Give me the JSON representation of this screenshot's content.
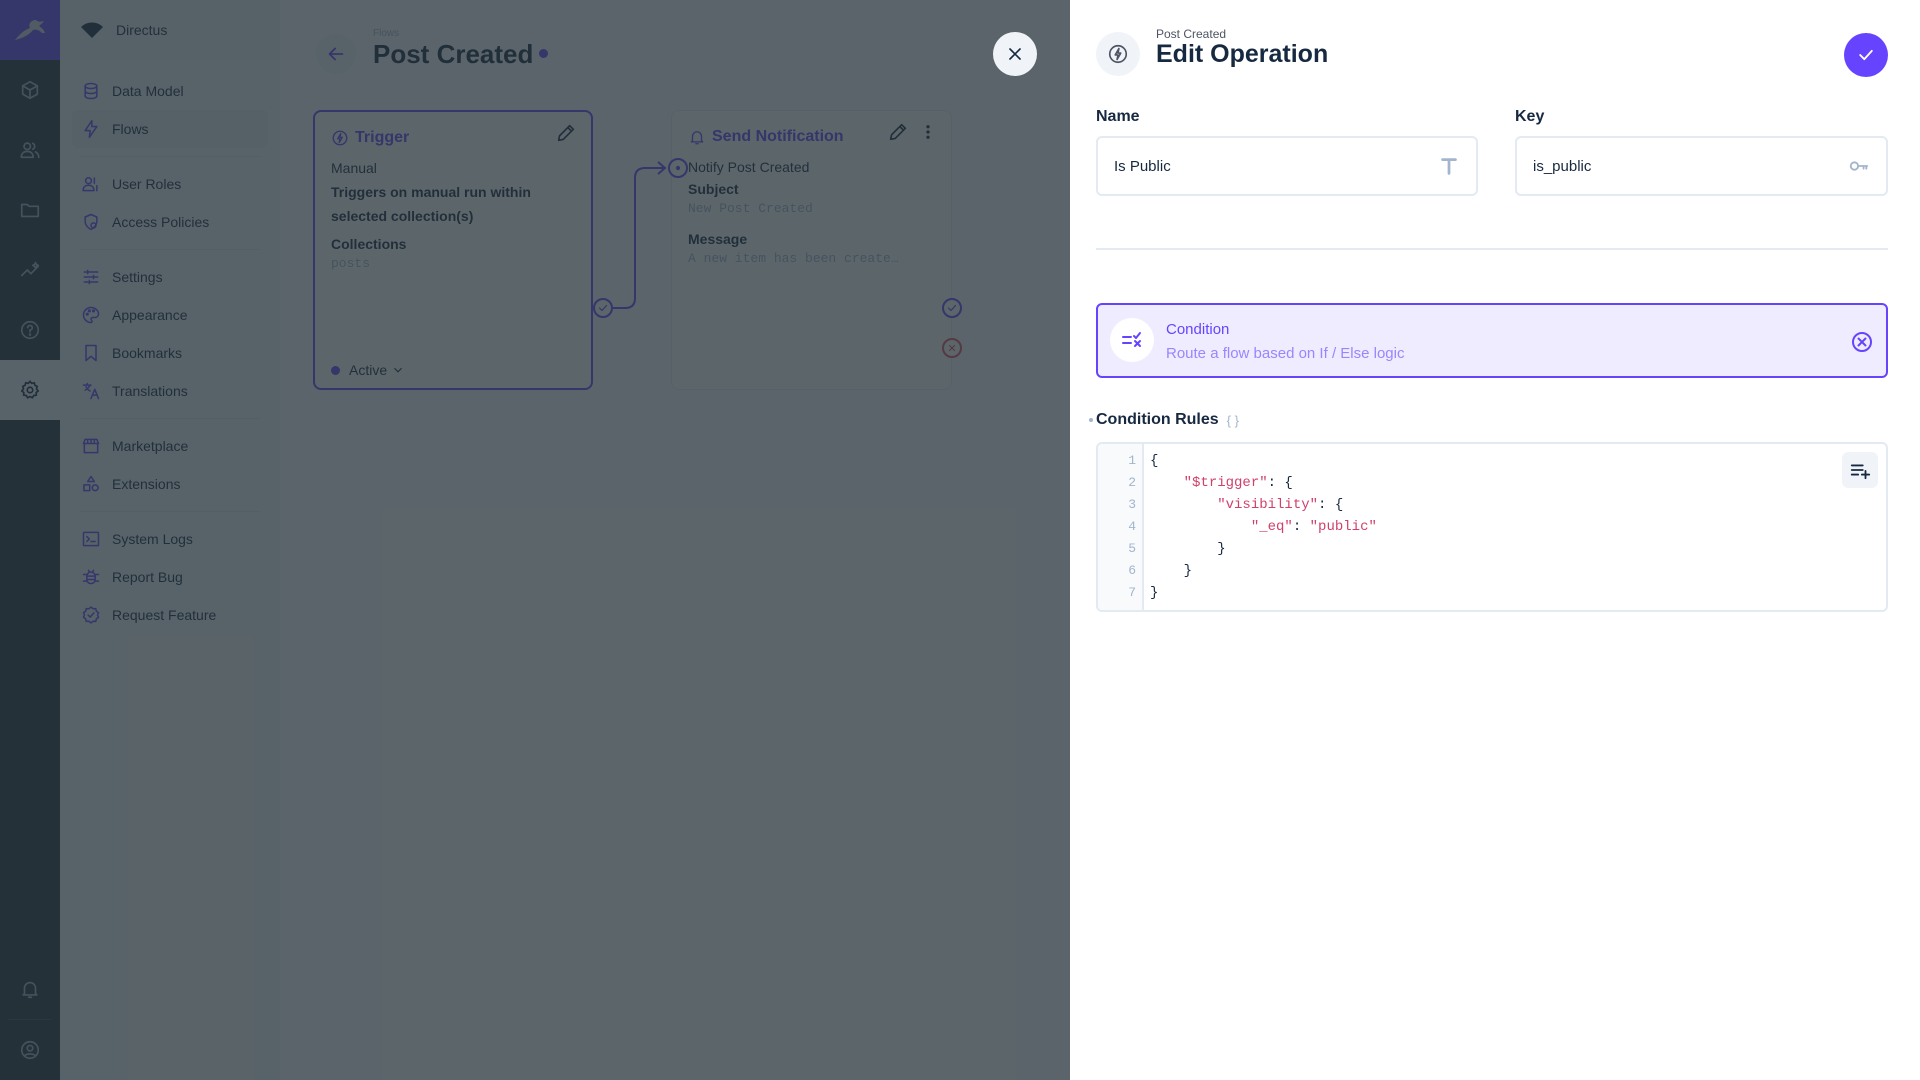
{
  "module_bar": {
    "items": [
      {
        "name": "content",
        "icon": "cube-icon"
      },
      {
        "name": "users",
        "icon": "users-icon"
      },
      {
        "name": "files",
        "icon": "folder-icon"
      },
      {
        "name": "insights",
        "icon": "insights-icon"
      },
      {
        "name": "help",
        "icon": "help-icon"
      },
      {
        "name": "settings",
        "icon": "gear-icon",
        "active": true
      }
    ],
    "bottom": [
      {
        "name": "notifications",
        "icon": "bell-icon"
      },
      {
        "name": "account",
        "icon": "account-icon"
      }
    ]
  },
  "nav": {
    "project": "Directus",
    "groups": [
      [
        {
          "label": "Data Model",
          "icon": "database-icon"
        },
        {
          "label": "Flows",
          "icon": "bolt-icon",
          "active": true
        }
      ],
      [
        {
          "label": "User Roles",
          "icon": "user-roles-icon"
        },
        {
          "label": "Access Policies",
          "icon": "shield-icon"
        }
      ],
      [
        {
          "label": "Settings",
          "icon": "sliders-icon"
        },
        {
          "label": "Appearance",
          "icon": "palette-icon"
        },
        {
          "label": "Bookmarks",
          "icon": "bookmark-icon"
        },
        {
          "label": "Translations",
          "icon": "translate-icon"
        }
      ],
      [
        {
          "label": "Marketplace",
          "icon": "store-icon"
        },
        {
          "label": "Extensions",
          "icon": "shapes-icon"
        }
      ],
      [
        {
          "label": "System Logs",
          "icon": "terminal-icon"
        },
        {
          "label": "Report Bug",
          "icon": "bug-icon"
        },
        {
          "label": "Request Feature",
          "icon": "verified-icon"
        }
      ]
    ]
  },
  "flow": {
    "breadcrumb": "Flows",
    "title": "Post Created",
    "trigger": {
      "header": "Trigger",
      "type": "Manual",
      "description": "Triggers on manual run within selected collection(s)",
      "collections_label": "Collections",
      "collections_value": "posts",
      "status": "Active"
    },
    "operation": {
      "header": "Send Notification",
      "name": "Notify Post Created",
      "subject_label": "Subject",
      "subject_value": "New Post Created",
      "message_label": "Message",
      "message_value": "A new item has been create…"
    }
  },
  "drawer": {
    "breadcrumb": "Post Created",
    "title": "Edit Operation",
    "name_label": "Name",
    "name_value": "Is Public",
    "key_label": "Key",
    "key_value": "is_public",
    "operation_type": {
      "name": "Condition",
      "description": "Route a flow based on If / Else logic"
    },
    "rules_label": "Condition Rules",
    "rules_icon": "{ }",
    "code_lines": [
      {
        "n": "1",
        "parts": [
          {
            "t": "{",
            "s": false
          }
        ]
      },
      {
        "n": "2",
        "parts": [
          {
            "t": "    ",
            "s": false
          },
          {
            "t": "\"$trigger\"",
            "s": true
          },
          {
            "t": ": {",
            "s": false
          }
        ]
      },
      {
        "n": "3",
        "parts": [
          {
            "t": "        ",
            "s": false
          },
          {
            "t": "\"visibility\"",
            "s": true
          },
          {
            "t": ": {",
            "s": false
          }
        ]
      },
      {
        "n": "4",
        "parts": [
          {
            "t": "            ",
            "s": false
          },
          {
            "t": "\"_eq\"",
            "s": true
          },
          {
            "t": ": ",
            "s": false
          },
          {
            "t": "\"public\"",
            "s": true
          }
        ]
      },
      {
        "n": "5",
        "parts": [
          {
            "t": "        }",
            "s": false
          }
        ]
      },
      {
        "n": "6",
        "parts": [
          {
            "t": "    }",
            "s": false
          }
        ]
      },
      {
        "n": "7",
        "parts": [
          {
            "t": "}",
            "s": false
          }
        ]
      }
    ]
  },
  "colors": {
    "accent": "#6644ff",
    "module_bar": "#263238",
    "danger": "#e35169"
  }
}
